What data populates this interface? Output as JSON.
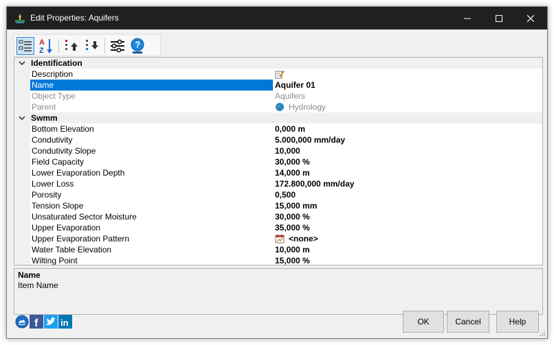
{
  "window": {
    "title": "Edit Properties: Aquifers",
    "minimize_glyph": "—",
    "maximize_glyph": "☐",
    "close_glyph": "✕"
  },
  "toolbar": {
    "buttons": [
      {
        "name": "categorized-view-button",
        "icon": "categorized-list-icon"
      },
      {
        "name": "alphabetical-sort-button",
        "icon": "sort-az-icon"
      },
      {
        "name": "move-up-button",
        "icon": "move-up-icon"
      },
      {
        "name": "move-down-button",
        "icon": "move-down-icon"
      },
      {
        "name": "settings-button",
        "icon": "sliders-icon"
      },
      {
        "name": "help-button",
        "icon": "help-icon"
      }
    ]
  },
  "grid": {
    "categories": [
      {
        "label": "Identification",
        "rows": [
          {
            "name": "Description",
            "value": "",
            "value_icon": "edit-text-icon",
            "readonly": false
          },
          {
            "name": "Name",
            "value": "Aquifer 01",
            "readonly": false,
            "selected": true
          },
          {
            "name": "Object Type",
            "value": "Aquifers",
            "readonly": true
          },
          {
            "name": "Parent",
            "value": "Hydrology",
            "value_icon": "globe-icon",
            "readonly": true
          }
        ]
      },
      {
        "label": "Swmm",
        "rows": [
          {
            "name": "Bottom Elevation",
            "value": "0,000 m"
          },
          {
            "name": "Condutivity",
            "value": "5.000,000 mm/day"
          },
          {
            "name": "Condutivity Slope",
            "value": "10,000"
          },
          {
            "name": "Field Capacity",
            "value": "30,000 %"
          },
          {
            "name": "Lower Evaporation Depth",
            "value": "14,000 m"
          },
          {
            "name": "Lower Loss",
            "value": "172.800,000 mm/day"
          },
          {
            "name": "Porosity",
            "value": "0,500"
          },
          {
            "name": "Tension Slope",
            "value": "15,000 mm"
          },
          {
            "name": "Unsaturated Sector Moisture",
            "value": "30,000 %"
          },
          {
            "name": "Upper Evaporation",
            "value": "35,000 %"
          },
          {
            "name": "Upper Evaporation Pattern",
            "value": "<none>",
            "value_icon": "pattern-icon"
          },
          {
            "name": "Water Table Elevation",
            "value": "10,000 m"
          },
          {
            "name": "Wilting Point",
            "value": "15,000 %"
          }
        ]
      }
    ]
  },
  "help": {
    "title": "Name",
    "description": "Item Name"
  },
  "buttons": {
    "ok": "OK",
    "cancel": "Cancel",
    "help": "Help"
  },
  "social": [
    "app-logo-icon",
    "facebook-icon",
    "twitter-icon",
    "linkedin-icon"
  ],
  "colors": {
    "titlebar": "#202020",
    "selection": "#0078d7",
    "category_bg": "#f0f0f0",
    "facebook": "#3b5998",
    "twitter": "#1da1f2",
    "linkedin": "#0077b5"
  }
}
